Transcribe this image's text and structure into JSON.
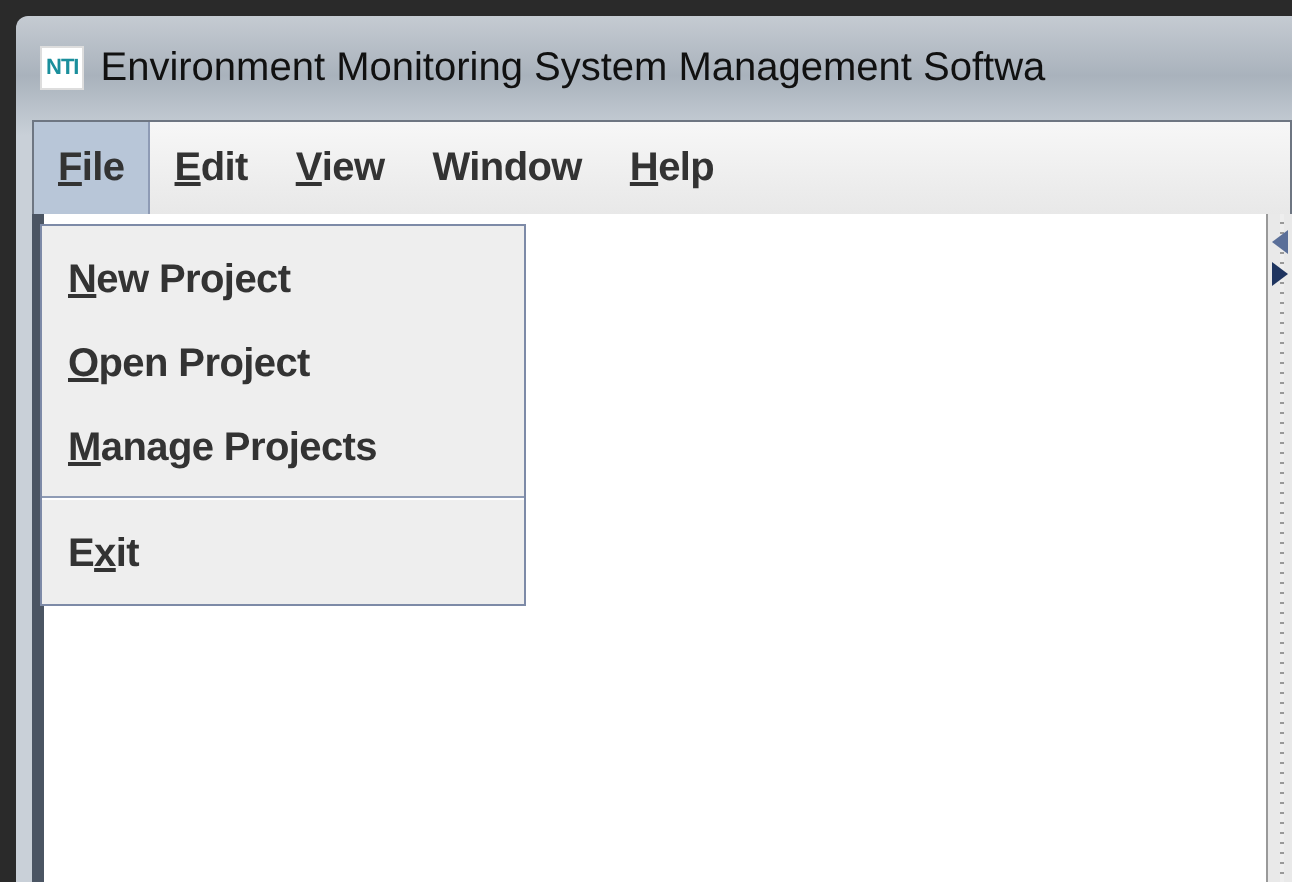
{
  "window": {
    "icon_text": "NTI",
    "title": "Environment Monitoring System Management Softwa"
  },
  "menubar": [
    {
      "key": "F",
      "after": "ile",
      "selected": true
    },
    {
      "key": "E",
      "after": "dit",
      "selected": false
    },
    {
      "key": "V",
      "after": "iew",
      "selected": false
    },
    {
      "text": "Window",
      "selected": false
    },
    {
      "key": "H",
      "after": "elp",
      "selected": false
    }
  ],
  "file_menu": [
    {
      "kind": "item",
      "key": "N",
      "after": "ew Project"
    },
    {
      "kind": "item",
      "key": "O",
      "after": "pen Project"
    },
    {
      "kind": "item",
      "key": "M",
      "after": "anage Projects"
    },
    {
      "kind": "separator"
    },
    {
      "kind": "item",
      "before": "E",
      "key": "x",
      "after": "it"
    }
  ]
}
